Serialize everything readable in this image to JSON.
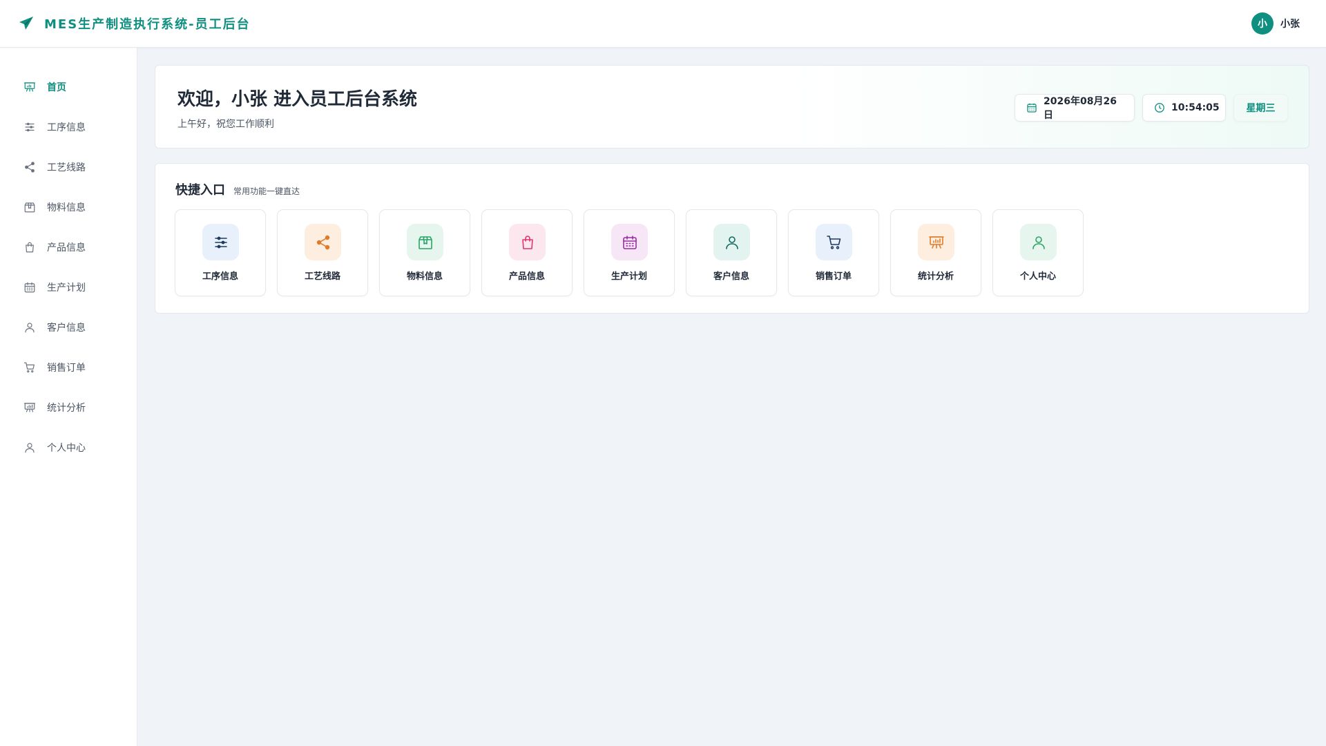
{
  "header": {
    "title": "MES生产制造执行系统-员工后台",
    "brand_icon": "paper-plane-icon",
    "user": {
      "avatar_text": "小",
      "name": "小张"
    }
  },
  "colors": {
    "accent": "#0f8f7f",
    "background": "#f0f3f7"
  },
  "sidebar": {
    "items": [
      {
        "label": "首页",
        "icon": "presentation-board-icon",
        "active": true
      },
      {
        "label": "工序信息",
        "icon": "sliders-icon"
      },
      {
        "label": "工艺线路",
        "icon": "share-nodes-icon"
      },
      {
        "label": "物料信息",
        "icon": "package-icon"
      },
      {
        "label": "产品信息",
        "icon": "shopping-bag-icon"
      },
      {
        "label": "生产计划",
        "icon": "calendar-icon"
      },
      {
        "label": "客户信息",
        "icon": "user-icon"
      },
      {
        "label": "销售订单",
        "icon": "shopping-cart-icon"
      },
      {
        "label": "统计分析",
        "icon": "presentation-chart-icon"
      },
      {
        "label": "个人中心",
        "icon": "user-icon"
      }
    ]
  },
  "welcome": {
    "title": "欢迎，小张 进入员工后台系统",
    "subtitle": "上午好，祝您工作顺利",
    "date": "2026年08月26日",
    "time": "10:54:05",
    "weekday": "星期三"
  },
  "quick": {
    "title": "快捷入口",
    "subtitle": "常用功能一键直达",
    "cards": [
      {
        "label": "工序信息",
        "icon": "sliders-icon",
        "bg": "#e8f1fb",
        "color": "#1e3a5f"
      },
      {
        "label": "工艺线路",
        "icon": "share-nodes-icon",
        "bg": "#fdeee0",
        "color": "#e07b2a"
      },
      {
        "label": "物料信息",
        "icon": "package-icon",
        "bg": "#e6f6ee",
        "color": "#27a566"
      },
      {
        "label": "产品信息",
        "icon": "shopping-bag-icon",
        "bg": "#fde7ee",
        "color": "#e0336a"
      },
      {
        "label": "生产计划",
        "icon": "calendar-icon",
        "bg": "#f6e6f6",
        "color": "#9b2aa3"
      },
      {
        "label": "客户信息",
        "icon": "user-icon",
        "bg": "#e2f3f0",
        "color": "#0f6b5f"
      },
      {
        "label": "销售订单",
        "icon": "shopping-cart-icon",
        "bg": "#e8f1fb",
        "color": "#1e3a5f"
      },
      {
        "label": "统计分析",
        "icon": "presentation-chart-icon",
        "bg": "#fdeee0",
        "color": "#e07b2a"
      },
      {
        "label": "个人中心",
        "icon": "user-icon",
        "bg": "#e6f6ee",
        "color": "#27a566"
      }
    ]
  }
}
